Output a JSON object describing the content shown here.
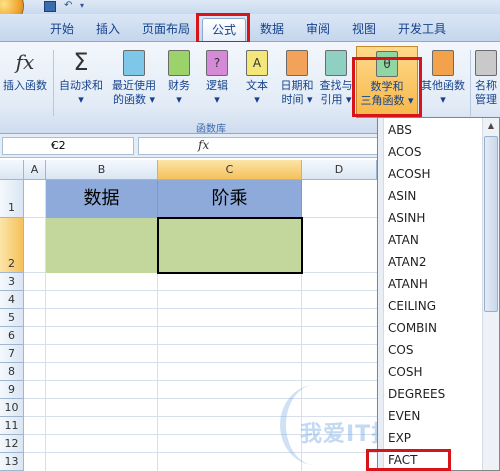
{
  "tabs": [
    "开始",
    "插入",
    "页面布局",
    "公式",
    "数据",
    "审阅",
    "视图",
    "开发工具"
  ],
  "ribbon": {
    "buttons": [
      {
        "icon_glyph": "fx",
        "line1": "插入函数",
        "line2": ""
      },
      {
        "icon_glyph": "Σ",
        "line1": "自动求和",
        "line2": "▾"
      },
      {
        "icon_glyph": "",
        "line1": "最近使用",
        "line2": "的函数 ▾"
      },
      {
        "icon_glyph": "",
        "line1": "财务",
        "line2": "▾"
      },
      {
        "icon_glyph": "?",
        "line1": "逻辑",
        "line2": "▾"
      },
      {
        "icon_glyph": "A",
        "line1": "文本",
        "line2": "▾"
      },
      {
        "icon_glyph": "",
        "line1": "日期和",
        "line2": "时间 ▾"
      },
      {
        "icon_glyph": "",
        "line1": "查找与",
        "line2": "引用 ▾"
      },
      {
        "icon_glyph": "θ",
        "line1": "数学和",
        "line2": "三角函数 ▾"
      },
      {
        "icon_glyph": "",
        "line1": "其他函数",
        "line2": "▾"
      },
      {
        "icon_glyph": "",
        "line1": "名称",
        "line2": "管理"
      }
    ],
    "group_label": "函数库"
  },
  "formula_bar": {
    "name_box": "C2",
    "name_box_arrow": "▾",
    "fx_label": "fx"
  },
  "sheet": {
    "columns": [
      "",
      "A",
      "B",
      "C",
      "D"
    ],
    "rows": [
      "1",
      "2",
      "3",
      "4",
      "5",
      "6",
      "7",
      "8",
      "9",
      "10",
      "11",
      "12",
      "13"
    ],
    "cells": {
      "B1": "数据",
      "C1": "阶乘"
    },
    "colors": {
      "header_fill": "#8eaadb",
      "data_fill": "#c3d69b"
    }
  },
  "dropdown": {
    "items": [
      "ABS",
      "ACOS",
      "ACOSH",
      "ASIN",
      "ASINH",
      "ATAN",
      "ATAN2",
      "ATANH",
      "CEILING",
      "COMBIN",
      "COS",
      "COSH",
      "DEGREES",
      "EVEN",
      "EXP",
      "FACT"
    ],
    "highlight_color": "#d8141b"
  },
  "watermark": "我爱IT技术网"
}
